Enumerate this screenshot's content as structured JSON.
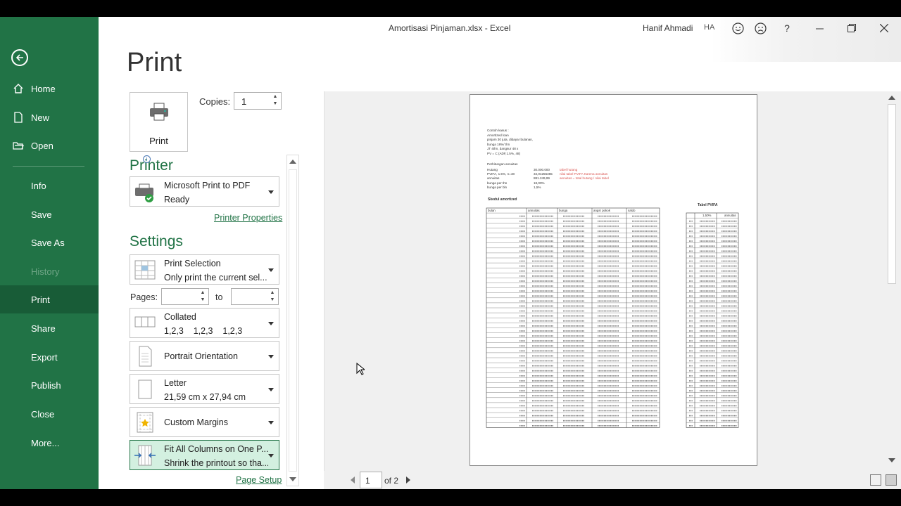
{
  "window": {
    "title": "Amortisasi Pinjaman.xlsx  -  Excel",
    "user_name": "Hanif Ahmadi",
    "user_initials": "HA"
  },
  "nav": {
    "items": [
      {
        "label": "Home"
      },
      {
        "label": "New"
      },
      {
        "label": "Open"
      },
      {
        "label": "Info"
      },
      {
        "label": "Save"
      },
      {
        "label": "Save As"
      },
      {
        "label": "History"
      },
      {
        "label": "Print"
      },
      {
        "label": "Share"
      },
      {
        "label": "Export"
      },
      {
        "label": "Publish"
      },
      {
        "label": "Close"
      },
      {
        "label": "More..."
      }
    ]
  },
  "print": {
    "heading": "Print",
    "button_label": "Print",
    "copies_label": "Copies:",
    "copies_value": "1"
  },
  "printer": {
    "heading": "Printer",
    "name": "Microsoft Print to PDF",
    "status": "Ready",
    "properties_link": "Printer Properties"
  },
  "settings": {
    "heading": "Settings",
    "what": {
      "title": "Print Selection",
      "subtitle": "Only print the current sel..."
    },
    "pages_label": "Pages:",
    "to_label": "to",
    "collation": {
      "title": "Collated",
      "subtitle": "1,2,3    1,2,3    1,2,3"
    },
    "orientation": {
      "title": "Portrait Orientation"
    },
    "paper": {
      "title": "Letter",
      "subtitle": "21,59 cm x 27,94 cm"
    },
    "margins": {
      "title": "Custom Margins"
    },
    "scaling": {
      "title": "Fit All Columns on One P...",
      "subtitle": "Shrink the printout so tha..."
    },
    "page_setup_link": "Page Setup"
  },
  "pager": {
    "current_page": "1",
    "of_text": "of 2"
  },
  "sheet": {
    "intro": [
      "Contoh kasus :",
      "Amortized loan",
      "pinjam 30 juta, dibayar bulanan,",
      "bunga 18%/ thn",
      "JT 4thn, dangsur 48 x",
      "PV = C (ADF,1.5%, 48)"
    ],
    "calc_title": "Perhitungan annuitas",
    "calc_rows": [
      {
        "label": "Hutang",
        "value": "30.000.000",
        "note": "tabel hutang"
      },
      {
        "label": "PVIFA, 1.5%, n=48",
        "value": "34,04255365",
        "note": "nilai tabel PVIFA Karena annuitas"
      },
      {
        "label": "annuitas",
        "value": "881.249,99",
        "note": "annuitas = total hutang / nilai tabel"
      },
      {
        "label": "bunga per thn",
        "value": "18,00%",
        "note": ""
      },
      {
        "label": "bunga per bln",
        "value": "1,5%",
        "note": ""
      }
    ],
    "schedule_title": "Skedul amortized",
    "schedule_headers": [
      "bulan",
      "annuitas",
      "bunga",
      "angsr pokok",
      "saldo"
    ],
    "pvifa_title": "Tabel PVIFA",
    "pvifa_headers": [
      "",
      "1,50%",
      "annuitas"
    ],
    "rows": 43
  }
}
